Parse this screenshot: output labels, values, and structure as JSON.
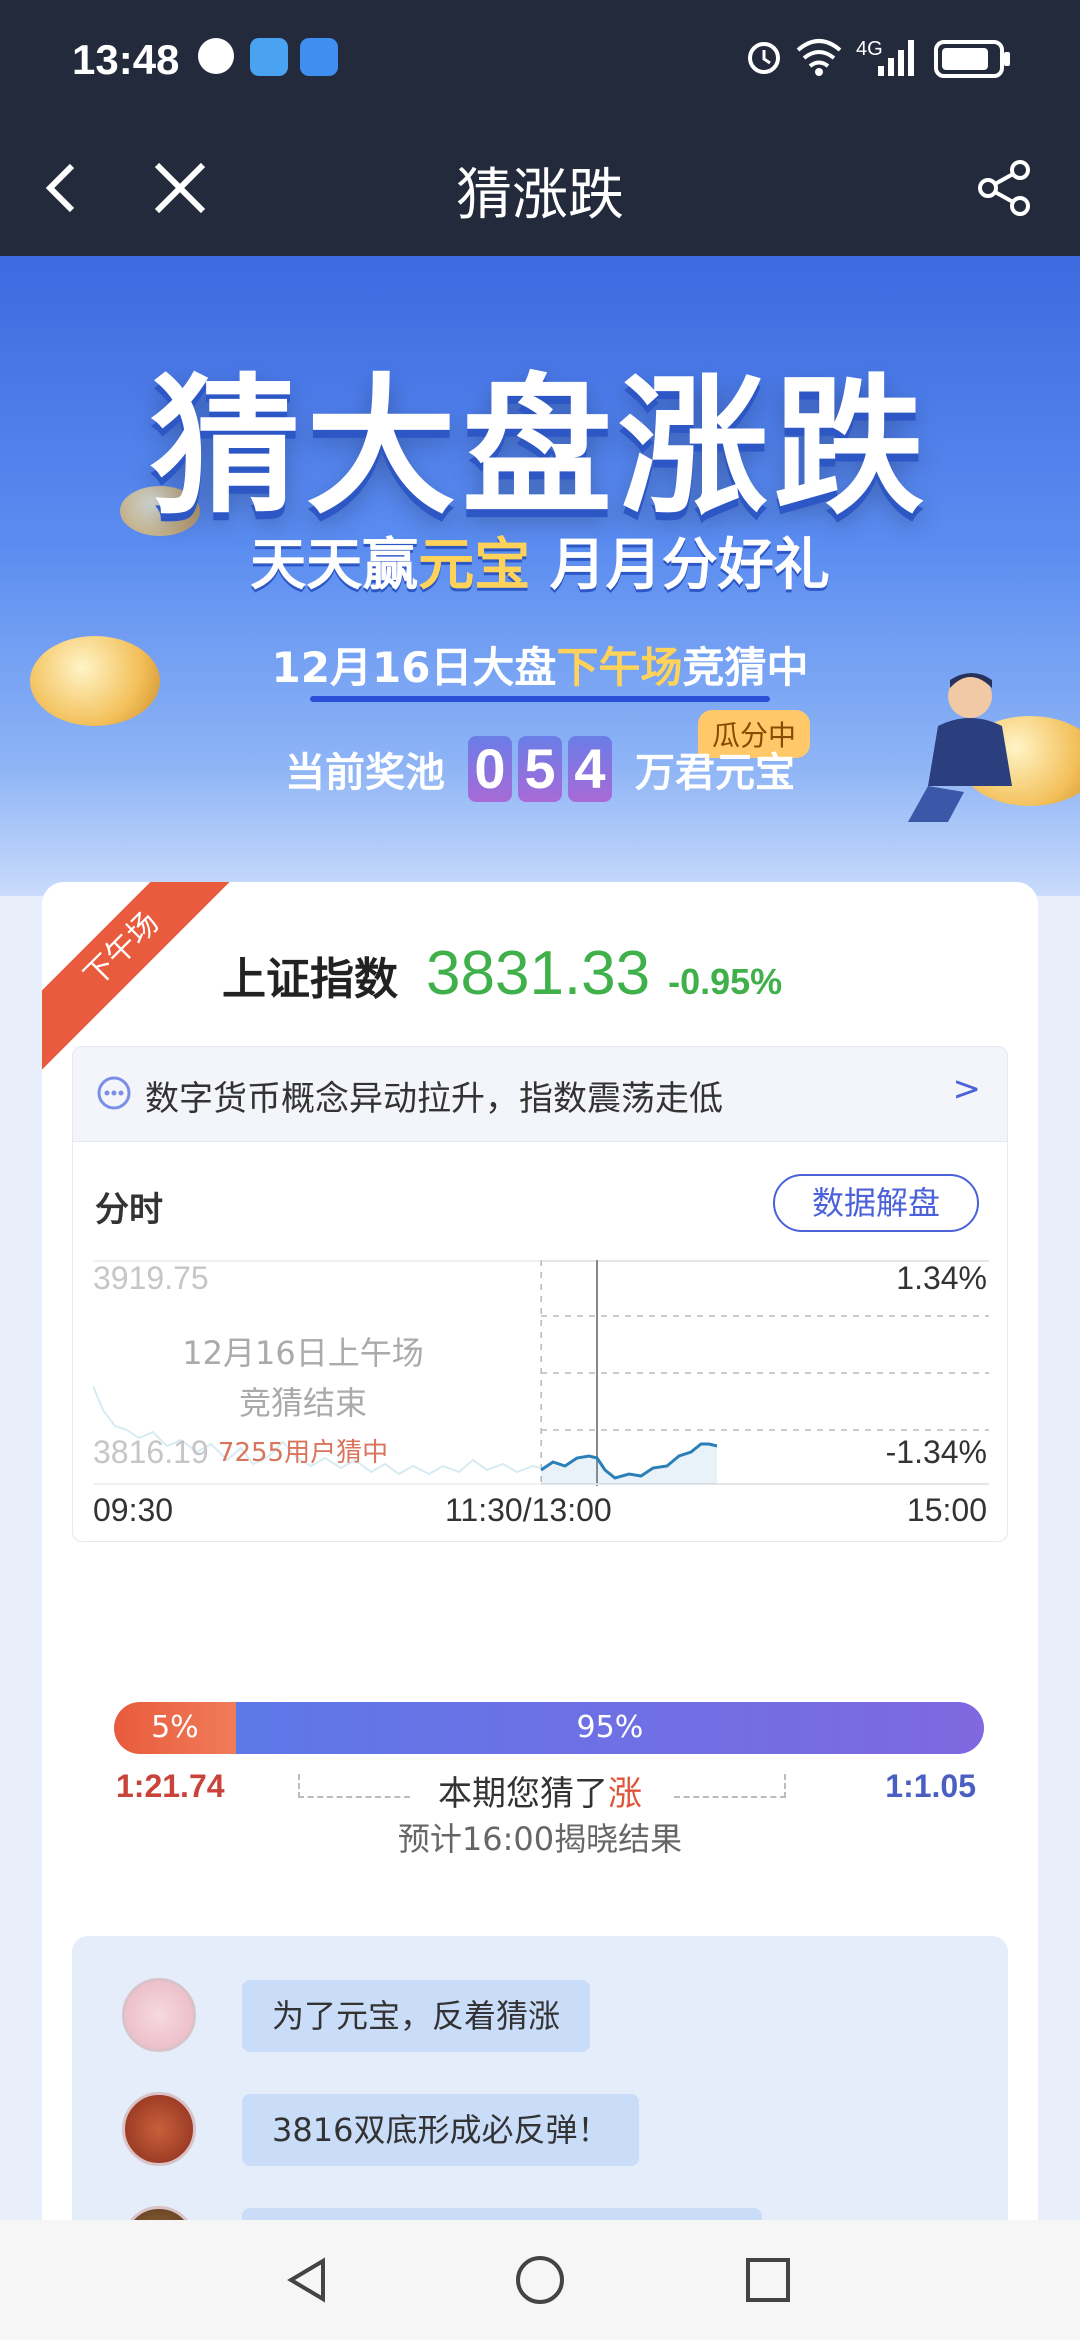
{
  "status_bar": {
    "time": "13:48",
    "signal": "4G",
    "network": "6"
  },
  "title_bar": {
    "title": "猜涨跌"
  },
  "banner": {
    "main_title": "猜大盘涨跌",
    "subtitle_part1": "天天赢",
    "subtitle_gold": "元宝",
    "subtitle_part2": " 月月分好礼",
    "session_prefix": "12月16日大盘",
    "session_gold": "下午场",
    "session_suffix": "竞猜中",
    "pool_label": "当前奖池",
    "pool_digits": [
      "0",
      "5",
      "4"
    ],
    "pool_unit": "万君元宝",
    "pool_tag": "瓜分中"
  },
  "card": {
    "ribbon": "下午场",
    "index_name": "上证指数",
    "index_value": "3831.33",
    "index_change": "-0.95%",
    "news": "数字货币概念异动拉升，指数震荡走低",
    "news_arrow": ">",
    "chart_tab": "分时",
    "data_button": "数据解盘",
    "chart": {
      "y_high": "3919.75",
      "y_low": "3816.19",
      "pct_high": "1.34%",
      "pct_low": "-1.34%",
      "x_start": "09:30",
      "x_mid": "11:30/13:00",
      "x_end": "15:00",
      "morning_label_1": "12月16日上午场",
      "morning_label_2": "竞猜结束",
      "morning_users": "7255用户猜中"
    },
    "vote": {
      "down_pct": "5%",
      "up_pct": "95%",
      "down_fraction": 0.14,
      "odds_down": "1:21.74",
      "odds_up": "1:1.05",
      "guess_prefix": "本期您猜了",
      "guess_choice": "涨",
      "reveal": "预计16:00揭晓结果"
    },
    "comments": [
      {
        "text": "为了元宝，反着猜涨"
      },
      {
        "text": "3816双底形成必反弹！"
      }
    ]
  },
  "colors": {
    "header_bg": "#222a3b",
    "up_red": "#e85b3c",
    "down_green": "#3fb04a",
    "accent_blue": "#4b62d8"
  }
}
